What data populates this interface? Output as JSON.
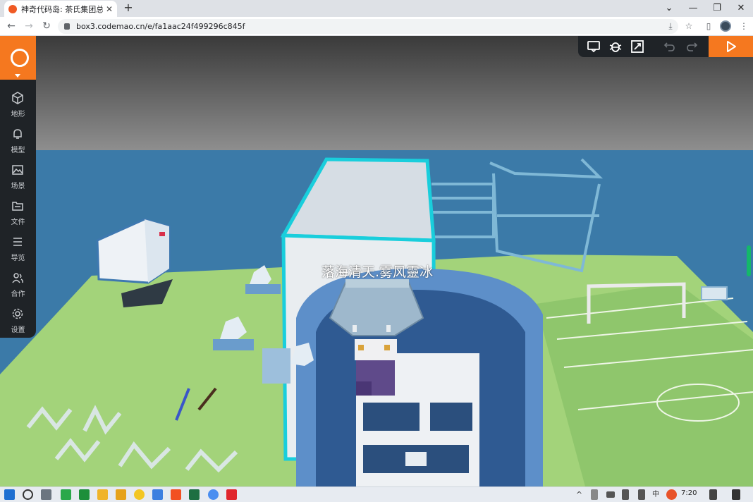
{
  "browser": {
    "tab_title": "神奇代码岛: 茶氏集团总部",
    "tab_close": "✕",
    "new_tab": "+",
    "url": "box3.codemao.cn/e/fa1aac24f499296c845f",
    "window_controls": [
      "⌄",
      "—",
      "❐",
      "✕"
    ]
  },
  "sidebar": {
    "items": [
      {
        "label": "地形",
        "icon": "cube-icon"
      },
      {
        "label": "模型",
        "icon": "bell-icon"
      },
      {
        "label": "场景",
        "icon": "image-icon"
      },
      {
        "label": "文件",
        "icon": "folder-icon"
      },
      {
        "label": "导览",
        "icon": "list-icon"
      },
      {
        "label": "合作",
        "icon": "people-icon"
      },
      {
        "label": "设置",
        "icon": "gear-icon"
      }
    ]
  },
  "editor_toolbar": {
    "icons": [
      "chat-icon",
      "bug-icon",
      "resize-icon",
      "undo-icon",
      "redo-icon",
      "play-icon"
    ]
  },
  "scene": {
    "player_name": "落海清天.雾风靈冰"
  },
  "taskbar": {
    "clock": "7:20",
    "ime": "中",
    "colors": {
      "accent": "#f5781f",
      "sidebar": "#1f2327",
      "sky_top": "#3c3c3c",
      "sea": "#3b7aa8",
      "grass": "#9ccf74"
    }
  }
}
